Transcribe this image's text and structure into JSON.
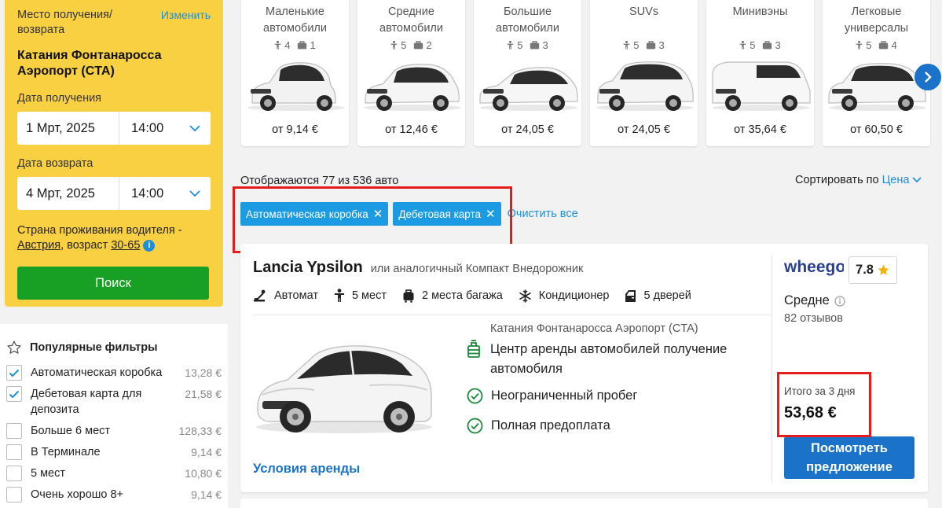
{
  "search": {
    "location_label": "Место получения/ возврата",
    "change_label": "Изменить",
    "location": "Катания Фонтанаросса Аэропорт (CTA)",
    "pickup_label": "Дата получения",
    "pickup_date": "1 Мрт, 2025",
    "pickup_time": "14:00",
    "return_label": "Дата возврата",
    "return_date": "4 Мрт, 2025",
    "return_time": "14:00",
    "country_prefix": "Страна проживания водителя -",
    "country": "Австрия",
    "age_prefix": ", возраст",
    "age": "30-65",
    "info": "i",
    "search_button": "Поиск"
  },
  "filters": {
    "title": "Популярные фильтры",
    "items": [
      {
        "label": "Автоматическая коробка",
        "price": "13,28 €",
        "checked": true
      },
      {
        "label": "Дебетовая карта для депозита",
        "price": "21,58 €",
        "checked": true
      },
      {
        "label": "Больше 6 мест",
        "price": "128,33 €",
        "checked": false
      },
      {
        "label": "В Терминале",
        "price": "9,14 €",
        "checked": false
      },
      {
        "label": "5 мест",
        "price": "10,80 €",
        "checked": false
      },
      {
        "label": "Очень хорошо 8+",
        "price": "9,14 €",
        "checked": false
      }
    ]
  },
  "categories": [
    {
      "name": "Маленькие автомобили",
      "seats": "4",
      "bags": "1",
      "price": "от 9,14 €"
    },
    {
      "name": "Средние автомобили",
      "seats": "5",
      "bags": "2",
      "price": "от 12,46 €"
    },
    {
      "name": "Большие автомобили",
      "seats": "5",
      "bags": "3",
      "price": "от 24,05 €"
    },
    {
      "name": "SUVs",
      "seats": "5",
      "bags": "3",
      "price": "от 24,05 €"
    },
    {
      "name": "Минивэны",
      "seats": "5",
      "bags": "3",
      "price": "от 35,64 €"
    },
    {
      "name": "Легковые универсалы",
      "seats": "5",
      "bags": "4",
      "price": "от 60,50 €"
    }
  ],
  "results": {
    "count_text": "Отображаются 77 из 536 авто",
    "sort_label": "Сортировать по",
    "sort_value": "Цена",
    "chips": [
      "Автоматическая коробка",
      "Дебетовая карта"
    ],
    "chip_close": "✕",
    "clear_all": "Очистить все"
  },
  "offer": {
    "model": "Lancia Ypsilon",
    "similar": "или аналогичный Компакт Внедорожник",
    "features": {
      "transmission": "Автомат",
      "seats": "5 мест",
      "bags": "2 места багажа",
      "ac": "Кондиционер",
      "doors": "5 дверей"
    },
    "pickup_location": "Катания Фонтанаросса Аэропорт (CTA)",
    "pickup_desc": "Центр аренды автомобилей получение автомобиля",
    "perks": [
      "Неограниченный пробег",
      "Полная предоплата"
    ],
    "terms_link": "Условия аренды",
    "supplier": "wheego",
    "rating": "7.8",
    "rating_word": "Средне",
    "reviews": "82 отзывов",
    "total_label": "Итого за 3 дня",
    "total_price": "53,68 €",
    "button_line1": "Посмотреть",
    "button_line2": "предложение"
  },
  "colors": {
    "search_panel": "#f9d042",
    "search_button": "#17a024",
    "link": "#1d8fd8",
    "primary_button": "#1a73c9",
    "chip": "#1d9be2",
    "highlight": "#e51c1c",
    "check": "#1a8a3a"
  }
}
